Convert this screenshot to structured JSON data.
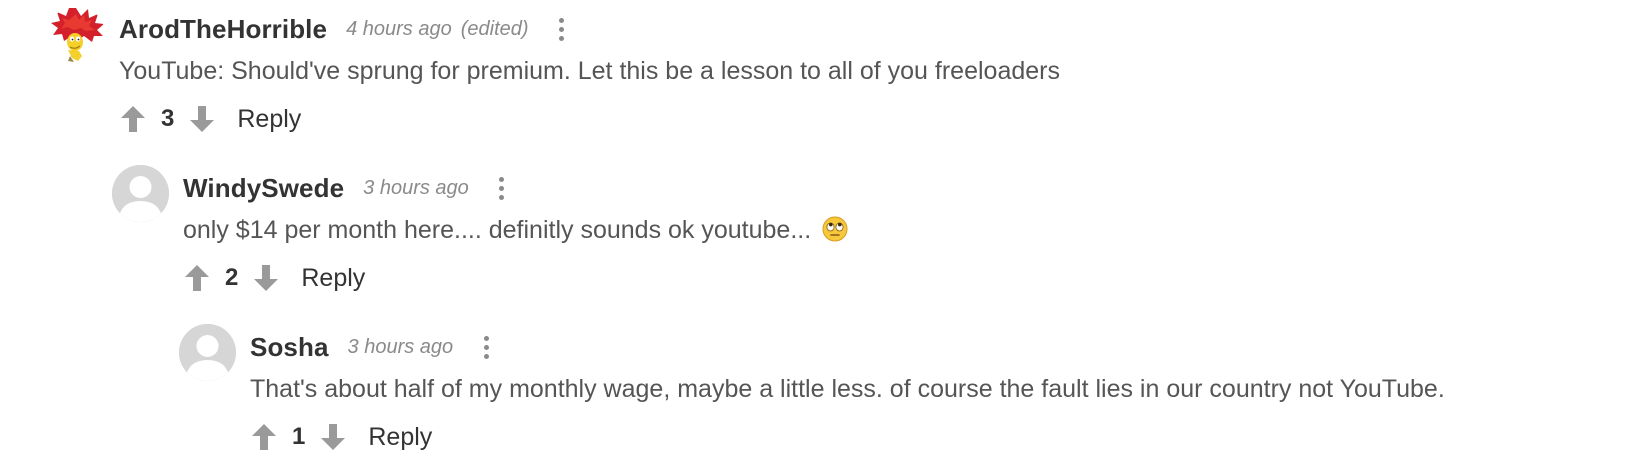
{
  "comments": [
    {
      "author": "ArodTheHorrible",
      "time": "4 hours ago",
      "edited": "(edited)",
      "text": "YouTube: Should've sprung for premium. Let this be a lesson to all of you freeloaders",
      "votes": "3",
      "reply_label": "Reply",
      "avatar": "sideshow-bob-avatar"
    },
    {
      "author": "WindySwede",
      "time": "3 hours ago",
      "text": "only $14 per month here.... definitly sounds ok youtube...",
      "emoji": "face-with-rolling-eyes-emoji",
      "votes": "2",
      "reply_label": "Reply",
      "avatar": "default-user-avatar"
    },
    {
      "author": "Sosha",
      "time": "3 hours ago",
      "text": "That's about half of my monthly wage, maybe a little less. of course the fault lies in our country not YouTube.",
      "votes": "1",
      "reply_label": "Reply",
      "avatar": "default-user-avatar"
    }
  ],
  "icons": {
    "upvote": "arrow-up-icon",
    "downvote": "arrow-down-icon",
    "menu": "more-vertical-icon"
  },
  "colors": {
    "author": "#333333",
    "body_text": "#555555",
    "meta_text": "#8a8a8a",
    "icon_gray": "#9a9a9a",
    "avatar_placeholder": "#d6d6d6"
  }
}
